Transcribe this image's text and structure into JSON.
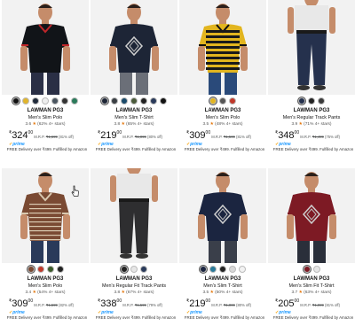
{
  "products": [
    {
      "brand": "LAWMAN PG3",
      "name": "Men's Slim Polo",
      "rating": "3.6",
      "rating_note": "(62% 4+ stars)",
      "currency": "₹",
      "price": "324",
      "price_sup": "00",
      "mrp_label": "M.R.P.",
      "mrp": "₹1,699",
      "discount": "(81% off)",
      "prime": "prime",
      "delivery": "FREE Delivery over ₹499. Fulfilled by Amazon",
      "shirt_color": "#111418",
      "trim_color": "#c0262a",
      "pants_color": "#2a2f45",
      "swatches": [
        "#111111",
        "#e1b52c",
        "#1f2a3a",
        "#eeeeee",
        "#4a5560",
        "#333333",
        "#2a7a5a"
      ],
      "selected": 0
    },
    {
      "brand": "LAWMAN PG3",
      "name": "Men's Slim T-Shirt",
      "rating": "3.8",
      "rating_note": "(65% 4+ stars)",
      "currency": "₹",
      "price": "219",
      "price_sup": "00",
      "mrp_label": "M.R.P.",
      "mrp": "₹1,099",
      "discount": "(80% off)",
      "prime": "prime",
      "delivery": "FREE Delivery over ₹499. Fulfilled by Amazon",
      "shirt_color": "#1d2536",
      "trim_color": "#1d2536",
      "pants_color": "#6b6f78",
      "swatches": [
        "#1d2536",
        "#3a3f44",
        "#1a4a6a",
        "#4a5a3a",
        "#222222",
        "#2a3a5a",
        "#111111"
      ],
      "selected": 0
    },
    {
      "brand": "LAWMAN PG3",
      "name": "Men's Slim Polo",
      "rating": "3.5",
      "rating_note": "(48% 4+ stars)",
      "currency": "₹",
      "price": "309",
      "price_sup": "00",
      "mrp_label": "M.R.P.",
      "mrp": "₹1,599",
      "discount": "(81% off)",
      "prime": "prime",
      "delivery": "FREE Delivery over ₹499. Fulfilled by Amazon",
      "shirt_color": "#e2b51f",
      "trim_color": "#111111",
      "pants_color": "#2a4a7a",
      "swatches": [
        "#e2b51f",
        "#555555",
        "#c0392b"
      ],
      "selected": 0
    },
    {
      "brand": "LAWMAN PG3",
      "name": "Men's Regular Track Pants",
      "rating": "3.9",
      "rating_note": "(71% 4+ stars)",
      "currency": "₹",
      "price": "348",
      "price_sup": "00",
      "mrp_label": "M.R.P.",
      "mrp": "₹1,499",
      "discount": "(75% off)",
      "prime": "prime",
      "delivery": "FREE Delivery over ₹499. Fulfilled by Amazon",
      "shirt_color": "#e8e8e8",
      "trim_color": "#e8e8e8",
      "pants_color": "#25314d",
      "swatches": [
        "#25314d",
        "#222222",
        "#3a3a3a"
      ],
      "selected": 0
    },
    {
      "brand": "LAWMAN PG3",
      "name": "Men's Slim Polo",
      "rating": "3.4",
      "rating_note": "(54% 4+ stars)",
      "currency": "₹",
      "price": "309",
      "price_sup": "00",
      "mrp_label": "M.R.P.",
      "mrp": "₹1,599",
      "discount": "(82% off)",
      "prime": "prime",
      "delivery": "FREE Delivery over ₹499. Fulfilled by Amazon",
      "shirt_color": "#7a4a33",
      "trim_color": "#d9c9b0",
      "pants_color": "#2a3a5a",
      "swatches": [
        "#7a4a33",
        "#c0392b",
        "#3a5a2a",
        "#222222"
      ],
      "selected": 0
    },
    {
      "brand": "LAWMAN PG3",
      "name": "Men's Regular Fit Track Pants",
      "rating": "3.8",
      "rating_note": "(67% 4+ stars)",
      "currency": "₹",
      "price": "338",
      "price_sup": "00",
      "mrp_label": "M.R.P.",
      "mrp": "₹1,599",
      "discount": "(79% off)",
      "prime": "prime",
      "delivery": "FREE Delivery over ₹499. Fulfilled by Amazon",
      "shirt_color": "#e8e8e8",
      "trim_color": "#e8e8e8",
      "pants_color": "#2e2e30",
      "swatches": [
        "#222222",
        "#e6e6e6",
        "#2a3a5a"
      ],
      "selected": 0
    },
    {
      "brand": "LAWMAN PG3",
      "name": "Men's Slim T-Shirt",
      "rating": "3.5",
      "rating_note": "(50% 4+ stars)",
      "currency": "₹",
      "price": "219",
      "price_sup": "00",
      "mrp_label": "M.R.P.",
      "mrp": "₹1,099",
      "discount": "(80% off)",
      "prime": "prime",
      "delivery": "FREE Delivery over ₹499. Fulfilled by Amazon",
      "shirt_color": "#1b2540",
      "trim_color": "#1b2540",
      "pants_color": "#3a3f4a",
      "swatches": [
        "#1b2540",
        "#2a7a9a",
        "#222222",
        "#d8d8d8",
        "#f2f2f2"
      ],
      "selected": 0
    },
    {
      "brand": "LAWMAN PG3",
      "name": "Men's Slim Fit T-Shirt",
      "rating": "3.7",
      "rating_note": "(63% 4+ stars)",
      "currency": "₹",
      "price": "205",
      "price_sup": "00",
      "mrp_label": "M.R.P.",
      "mrp": "₹1,099",
      "discount": "(81% off)",
      "prime": "prime",
      "delivery": "FREE Delivery over ₹499. Fulfilled by Amazon",
      "shirt_color": "#7d1a24",
      "trim_color": "#7d1a24",
      "pants_color": "#2a2f3a",
      "swatches": [
        "#7d1a24",
        "#e6e6e6"
      ],
      "selected": 0
    }
  ]
}
